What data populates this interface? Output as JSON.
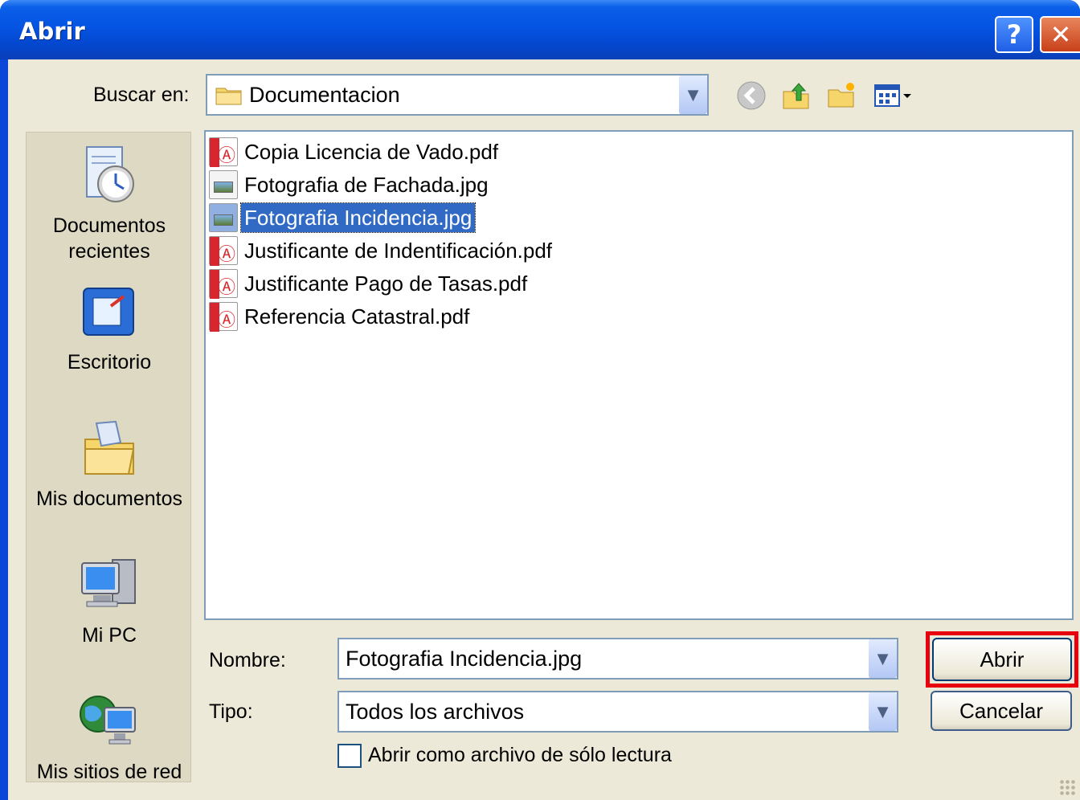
{
  "window": {
    "title": "Abrir",
    "help_glyph": "?",
    "close_glyph": "✕"
  },
  "lookin": {
    "label": "Buscar en:",
    "value": "Documentacion"
  },
  "places": [
    {
      "label": "Documentos recientes",
      "icon": "recent-documents-icon"
    },
    {
      "label": "Escritorio",
      "icon": "desktop-icon"
    },
    {
      "label": "Mis documentos",
      "icon": "my-documents-icon"
    },
    {
      "label": "Mi PC",
      "icon": "my-computer-icon"
    },
    {
      "label": "Mis sitios de red",
      "icon": "network-places-icon"
    }
  ],
  "files": [
    {
      "name": "Copia Licencia de Vado.pdf",
      "type": "pdf"
    },
    {
      "name": "Fotografia de Fachada.jpg",
      "type": "jpg"
    },
    {
      "name": "Fotografia Incidencia.jpg",
      "type": "jpg",
      "selected": true
    },
    {
      "name": "Justificante de Indentificación.pdf",
      "type": "pdf"
    },
    {
      "name": "Justificante Pago de Tasas.pdf",
      "type": "pdf"
    },
    {
      "name": "Referencia Catastral.pdf",
      "type": "pdf"
    }
  ],
  "filename": {
    "label": "Nombre:",
    "value": "Fotografia Incidencia.jpg"
  },
  "filetype": {
    "label": "Tipo:",
    "value": "Todos los archivos"
  },
  "readonly": {
    "label": "Abrir como archivo de sólo lectura",
    "checked": false
  },
  "buttons": {
    "open": "Abrir",
    "cancel": "Cancelar"
  },
  "colors": {
    "titlebar": "#0554e3",
    "selection": "#316ac5",
    "highlight": "#e8000f",
    "dialog_bg": "#ece9d8"
  }
}
